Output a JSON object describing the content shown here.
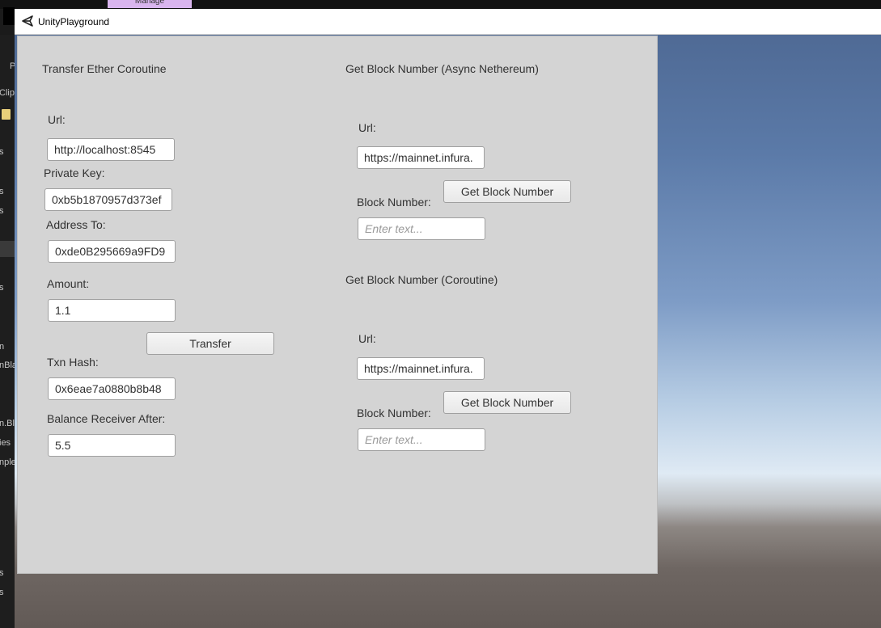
{
  "window": {
    "title": "UnityPlayground"
  },
  "background": {
    "tab_fragment": "Manage",
    "left_fragments": [
      "P",
      "Clip",
      "s",
      "s",
      "s",
      "s",
      "n",
      "nBla",
      "n.Bl",
      "ies",
      "nple",
      "s",
      "s"
    ]
  },
  "transfer": {
    "heading": "Transfer Ether Coroutine",
    "url_label": "Url:",
    "url_value": "http://localhost:8545",
    "private_key_label": "Private Key:",
    "private_key_value": "0xb5b1870957d373ef",
    "address_to_label": "Address To:",
    "address_to_value": "0xde0B295669a9FD9",
    "amount_label": "Amount:",
    "amount_value": "1.1",
    "transfer_button": "Transfer",
    "txn_hash_label": "Txn Hash:",
    "txn_hash_value": "0x6eae7a0880b8b48",
    "balance_label": "Balance Receiver After:",
    "balance_value": "5.5"
  },
  "async_block": {
    "heading": "Get Block Number (Async Nethereum)",
    "url_label": "Url:",
    "url_value": "https://mainnet.infura.",
    "get_button": "Get Block Number",
    "block_number_label": "Block Number:",
    "block_number_placeholder": "Enter text..."
  },
  "coroutine_block": {
    "heading": "Get Block Number (Coroutine)",
    "url_label": "Url:",
    "url_value": "https://mainnet.infura.",
    "get_button": "Get Block Number",
    "block_number_label": "Block Number:",
    "block_number_placeholder": "Enter text..."
  }
}
